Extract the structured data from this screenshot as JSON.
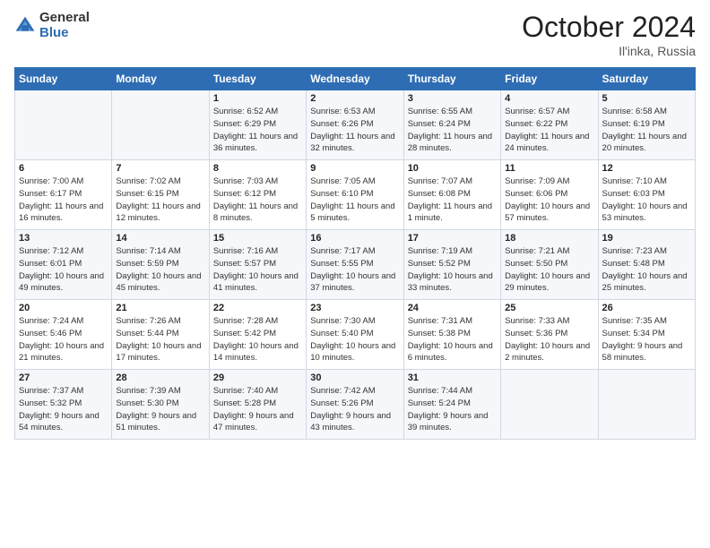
{
  "logo": {
    "general": "General",
    "blue": "Blue"
  },
  "header": {
    "month": "October 2024",
    "location": "Il'inka, Russia"
  },
  "weekdays": [
    "Sunday",
    "Monday",
    "Tuesday",
    "Wednesday",
    "Thursday",
    "Friday",
    "Saturday"
  ],
  "weeks": [
    [
      {
        "day": "",
        "info": ""
      },
      {
        "day": "",
        "info": ""
      },
      {
        "day": "1",
        "info": "Sunrise: 6:52 AM\nSunset: 6:29 PM\nDaylight: 11 hours and 36 minutes."
      },
      {
        "day": "2",
        "info": "Sunrise: 6:53 AM\nSunset: 6:26 PM\nDaylight: 11 hours and 32 minutes."
      },
      {
        "day": "3",
        "info": "Sunrise: 6:55 AM\nSunset: 6:24 PM\nDaylight: 11 hours and 28 minutes."
      },
      {
        "day": "4",
        "info": "Sunrise: 6:57 AM\nSunset: 6:22 PM\nDaylight: 11 hours and 24 minutes."
      },
      {
        "day": "5",
        "info": "Sunrise: 6:58 AM\nSunset: 6:19 PM\nDaylight: 11 hours and 20 minutes."
      }
    ],
    [
      {
        "day": "6",
        "info": "Sunrise: 7:00 AM\nSunset: 6:17 PM\nDaylight: 11 hours and 16 minutes."
      },
      {
        "day": "7",
        "info": "Sunrise: 7:02 AM\nSunset: 6:15 PM\nDaylight: 11 hours and 12 minutes."
      },
      {
        "day": "8",
        "info": "Sunrise: 7:03 AM\nSunset: 6:12 PM\nDaylight: 11 hours and 8 minutes."
      },
      {
        "day": "9",
        "info": "Sunrise: 7:05 AM\nSunset: 6:10 PM\nDaylight: 11 hours and 5 minutes."
      },
      {
        "day": "10",
        "info": "Sunrise: 7:07 AM\nSunset: 6:08 PM\nDaylight: 11 hours and 1 minute."
      },
      {
        "day": "11",
        "info": "Sunrise: 7:09 AM\nSunset: 6:06 PM\nDaylight: 10 hours and 57 minutes."
      },
      {
        "day": "12",
        "info": "Sunrise: 7:10 AM\nSunset: 6:03 PM\nDaylight: 10 hours and 53 minutes."
      }
    ],
    [
      {
        "day": "13",
        "info": "Sunrise: 7:12 AM\nSunset: 6:01 PM\nDaylight: 10 hours and 49 minutes."
      },
      {
        "day": "14",
        "info": "Sunrise: 7:14 AM\nSunset: 5:59 PM\nDaylight: 10 hours and 45 minutes."
      },
      {
        "day": "15",
        "info": "Sunrise: 7:16 AM\nSunset: 5:57 PM\nDaylight: 10 hours and 41 minutes."
      },
      {
        "day": "16",
        "info": "Sunrise: 7:17 AM\nSunset: 5:55 PM\nDaylight: 10 hours and 37 minutes."
      },
      {
        "day": "17",
        "info": "Sunrise: 7:19 AM\nSunset: 5:52 PM\nDaylight: 10 hours and 33 minutes."
      },
      {
        "day": "18",
        "info": "Sunrise: 7:21 AM\nSunset: 5:50 PM\nDaylight: 10 hours and 29 minutes."
      },
      {
        "day": "19",
        "info": "Sunrise: 7:23 AM\nSunset: 5:48 PM\nDaylight: 10 hours and 25 minutes."
      }
    ],
    [
      {
        "day": "20",
        "info": "Sunrise: 7:24 AM\nSunset: 5:46 PM\nDaylight: 10 hours and 21 minutes."
      },
      {
        "day": "21",
        "info": "Sunrise: 7:26 AM\nSunset: 5:44 PM\nDaylight: 10 hours and 17 minutes."
      },
      {
        "day": "22",
        "info": "Sunrise: 7:28 AM\nSunset: 5:42 PM\nDaylight: 10 hours and 14 minutes."
      },
      {
        "day": "23",
        "info": "Sunrise: 7:30 AM\nSunset: 5:40 PM\nDaylight: 10 hours and 10 minutes."
      },
      {
        "day": "24",
        "info": "Sunrise: 7:31 AM\nSunset: 5:38 PM\nDaylight: 10 hours and 6 minutes."
      },
      {
        "day": "25",
        "info": "Sunrise: 7:33 AM\nSunset: 5:36 PM\nDaylight: 10 hours and 2 minutes."
      },
      {
        "day": "26",
        "info": "Sunrise: 7:35 AM\nSunset: 5:34 PM\nDaylight: 9 hours and 58 minutes."
      }
    ],
    [
      {
        "day": "27",
        "info": "Sunrise: 7:37 AM\nSunset: 5:32 PM\nDaylight: 9 hours and 54 minutes."
      },
      {
        "day": "28",
        "info": "Sunrise: 7:39 AM\nSunset: 5:30 PM\nDaylight: 9 hours and 51 minutes."
      },
      {
        "day": "29",
        "info": "Sunrise: 7:40 AM\nSunset: 5:28 PM\nDaylight: 9 hours and 47 minutes."
      },
      {
        "day": "30",
        "info": "Sunrise: 7:42 AM\nSunset: 5:26 PM\nDaylight: 9 hours and 43 minutes."
      },
      {
        "day": "31",
        "info": "Sunrise: 7:44 AM\nSunset: 5:24 PM\nDaylight: 9 hours and 39 minutes."
      },
      {
        "day": "",
        "info": ""
      },
      {
        "day": "",
        "info": ""
      }
    ]
  ]
}
